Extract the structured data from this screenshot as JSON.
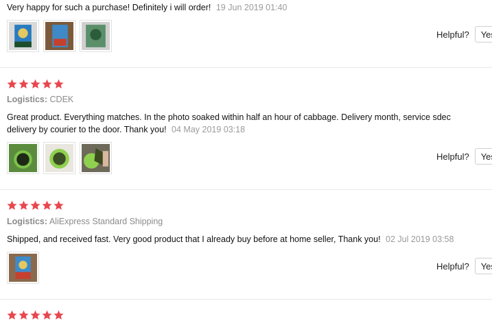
{
  "colors": {
    "star": "#e8474f",
    "muted": "#9a9a9a",
    "divider": "#e8e8e8"
  },
  "reviews": [
    {
      "text": "Very happy for such a purchase! Definitely i will order!",
      "date": "19 Jun 2019 01:40",
      "thumbs": [
        "product-photo-icon",
        "product-photo-icon",
        "product-photo-icon"
      ],
      "helpful_label": "Helpful?",
      "yes_label": "Yes"
    },
    {
      "stars": 5,
      "logistics_label": "Logistics:",
      "logistics_value": "CDEK",
      "text_line1": "Great product. Everything matches. In the photo soaked within half an hour of cabbage. Delivery month, service sdec",
      "text_line2": "delivery by courier to the door. Thank you!",
      "date": "04 May 2019 03:18",
      "thumbs": [
        "product-photo-icon",
        "product-photo-icon",
        "product-photo-icon"
      ],
      "helpful_label": "Helpful?",
      "yes_label": "Yes"
    },
    {
      "stars": 5,
      "logistics_label": "Logistics:",
      "logistics_value": "AliExpress Standard Shipping",
      "text": "Shipped, and received fast. Very good product that I already buy before at home seller, Thank you!",
      "date": "02 Jul 2019 03:58",
      "thumbs": [
        "product-photo-icon"
      ],
      "helpful_label": "Helpful?",
      "yes_label": "Yes"
    },
    {
      "stars": 5
    }
  ]
}
